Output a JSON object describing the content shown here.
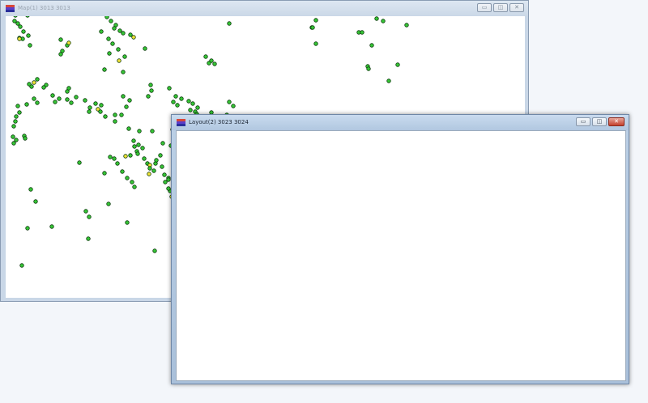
{
  "windows": {
    "map": {
      "title": "Map(1) 3013 3013",
      "controls": {
        "minimize": "▭",
        "maximize": "◫",
        "close": "✕"
      },
      "points": [
        [
          -12,
          -9,
          0
        ],
        [
          12,
          -1,
          0
        ],
        [
          18,
          -7,
          0
        ],
        [
          2,
          -4,
          1
        ],
        [
          23,
          -11,
          0
        ],
        [
          27,
          -1,
          0
        ],
        [
          11,
          6,
          0
        ],
        [
          15,
          9,
          0
        ],
        [
          18,
          13,
          0
        ],
        [
          22,
          19,
          0
        ],
        [
          17,
          27,
          0
        ],
        [
          28,
          24,
          0
        ],
        [
          21,
          28,
          0
        ],
        [
          30,
          36,
          0
        ],
        [
          17,
          28,
          1
        ],
        [
          68,
          29,
          0
        ],
        [
          76,
          36,
          0
        ],
        [
          70,
          43,
          0
        ],
        [
          78,
          33,
          1
        ],
        [
          68,
          47,
          0
        ],
        [
          125,
          1,
          0
        ],
        [
          130,
          6,
          0
        ],
        [
          136,
          11,
          0
        ],
        [
          134,
          15,
          0
        ],
        [
          141,
          18,
          0
        ],
        [
          145,
          21,
          0
        ],
        [
          154,
          23,
          0
        ],
        [
          158,
          26,
          1
        ],
        [
          118,
          19,
          0
        ],
        [
          127,
          28,
          0
        ],
        [
          132,
          34,
          0
        ],
        [
          139,
          41,
          0
        ],
        [
          147,
          50,
          0
        ],
        [
          140,
          55,
          1
        ],
        [
          128,
          46,
          0
        ],
        [
          122,
          66,
          0
        ],
        [
          145,
          69,
          0
        ],
        [
          172,
          40,
          0
        ],
        [
          276,
          9,
          0
        ],
        [
          282,
          -3,
          0
        ],
        [
          378,
          14,
          0
        ],
        [
          383,
          5,
          0
        ],
        [
          379,
          14,
          0
        ],
        [
          436,
          20,
          0
        ],
        [
          440,
          20,
          0
        ],
        [
          458,
          3,
          0
        ],
        [
          466,
          6,
          0
        ],
        [
          495,
          11,
          0
        ],
        [
          514,
          -3,
          0
        ],
        [
          383,
          34,
          0
        ],
        [
          452,
          36,
          0
        ],
        [
          247,
          50,
          0
        ],
        [
          254,
          55,
          0
        ],
        [
          258,
          59,
          0
        ],
        [
          251,
          58,
          0
        ],
        [
          447,
          62,
          0
        ],
        [
          448,
          65,
          0
        ],
        [
          484,
          60,
          0
        ],
        [
          473,
          80,
          0
        ],
        [
          39,
          78,
          0
        ],
        [
          32,
          87,
          0
        ],
        [
          35,
          82,
          1
        ],
        [
          29,
          84,
          0
        ],
        [
          50,
          85,
          0
        ],
        [
          47,
          88,
          0
        ],
        [
          58,
          98,
          0
        ],
        [
          76,
          93,
          0
        ],
        [
          78,
          89,
          0
        ],
        [
          66,
          102,
          0
        ],
        [
          76,
          103,
          0
        ],
        [
          61,
          106,
          0
        ],
        [
          87,
          100,
          0
        ],
        [
          81,
          107,
          0
        ],
        [
          98,
          104,
          0
        ],
        [
          104,
          113,
          0
        ],
        [
          111,
          108,
          0
        ],
        [
          114,
          115,
          1
        ],
        [
          117,
          118,
          0
        ],
        [
          103,
          118,
          0
        ],
        [
          123,
          124,
          0
        ],
        [
          118,
          110,
          0
        ],
        [
          135,
          122,
          0
        ],
        [
          135,
          130,
          0
        ],
        [
          145,
          99,
          0
        ],
        [
          153,
          104,
          0
        ],
        [
          149,
          112,
          0
        ],
        [
          179,
          85,
          0
        ],
        [
          180,
          92,
          0
        ],
        [
          176,
          99,
          0
        ],
        [
          143,
          122,
          0
        ],
        [
          152,
          139,
          0
        ],
        [
          15,
          111,
          0
        ],
        [
          17,
          119,
          0
        ],
        [
          13,
          124,
          0
        ],
        [
          12,
          130,
          0
        ],
        [
          10,
          136,
          0
        ],
        [
          26,
          109,
          0
        ],
        [
          35,
          102,
          0
        ],
        [
          39,
          107,
          0
        ],
        [
          202,
          89,
          0
        ],
        [
          210,
          99,
          0
        ],
        [
          207,
          106,
          0
        ],
        [
          217,
          102,
          0
        ],
        [
          212,
          110,
          0
        ],
        [
          226,
          105,
          0
        ],
        [
          231,
          108,
          0
        ],
        [
          237,
          113,
          0
        ],
        [
          234,
          118,
          0
        ],
        [
          228,
          116,
          0
        ],
        [
          244,
          125,
          0
        ],
        [
          247,
          133,
          0
        ],
        [
          276,
          106,
          0
        ],
        [
          281,
          111,
          0
        ],
        [
          273,
          122,
          0
        ],
        [
          236,
          121,
          0
        ],
        [
          206,
          140,
          0
        ],
        [
          214,
          148,
          0
        ],
        [
          212,
          135,
          0
        ],
        [
          219,
          133,
          0
        ],
        [
          158,
          154,
          0
        ],
        [
          164,
          159,
          0
        ],
        [
          169,
          163,
          0
        ],
        [
          162,
          167,
          0
        ],
        [
          154,
          172,
          0
        ],
        [
          148,
          173,
          1
        ],
        [
          159,
          161,
          0
        ],
        [
          163,
          170,
          0
        ],
        [
          171,
          176,
          0
        ],
        [
          175,
          182,
          0
        ],
        [
          178,
          184,
          1
        ],
        [
          178,
          188,
          0
        ],
        [
          183,
          191,
          0
        ],
        [
          177,
          195,
          1
        ],
        [
          185,
          182,
          0
        ],
        [
          186,
          178,
          0
        ],
        [
          191,
          172,
          0
        ],
        [
          194,
          157,
          0
        ],
        [
          204,
          160,
          0
        ],
        [
          181,
          142,
          0
        ],
        [
          165,
          142,
          0
        ],
        [
          193,
          186,
          0
        ],
        [
          196,
          196,
          0
        ],
        [
          201,
          200,
          0
        ],
        [
          209,
          198,
          0
        ],
        [
          201,
          202,
          0
        ],
        [
          203,
          216,
          0
        ],
        [
          205,
          223,
          1
        ],
        [
          207,
          210,
          0
        ],
        [
          201,
          213,
          0
        ],
        [
          197,
          205,
          0
        ],
        [
          23,
          148,
          0
        ],
        [
          24,
          151,
          0
        ],
        [
          9,
          149,
          0
        ],
        [
          13,
          153,
          0
        ],
        [
          10,
          157,
          0
        ],
        [
          91,
          181,
          0
        ],
        [
          129,
          174,
          0
        ],
        [
          134,
          176,
          0
        ],
        [
          138,
          182,
          0
        ],
        [
          144,
          192,
          0
        ],
        [
          150,
          200,
          0
        ],
        [
          156,
          205,
          0
        ],
        [
          159,
          211,
          0
        ],
        [
          122,
          194,
          0
        ],
        [
          31,
          214,
          0
        ],
        [
          37,
          229,
          0
        ],
        [
          99,
          241,
          0
        ],
        [
          103,
          248,
          0
        ],
        [
          127,
          232,
          0
        ],
        [
          150,
          255,
          0
        ],
        [
          57,
          260,
          0
        ],
        [
          27,
          262,
          0
        ],
        [
          184,
          290,
          0
        ],
        [
          102,
          275,
          0
        ],
        [
          20,
          308,
          0
        ],
        [
          208,
          264,
          0
        ],
        [
          254,
          119,
          0
        ],
        [
          -4,
          14,
          0
        ],
        [
          -6,
          18,
          0
        ]
      ]
    },
    "layout": {
      "title": "Layout(2) 3023 3024",
      "controls": {
        "minimize": "▭",
        "maximize": "◫",
        "close": "✕"
      }
    }
  },
  "colors": {
    "point_green": "#36c536",
    "point_yellow": "#f2e236",
    "point_outline": "#0c3a0c"
  }
}
